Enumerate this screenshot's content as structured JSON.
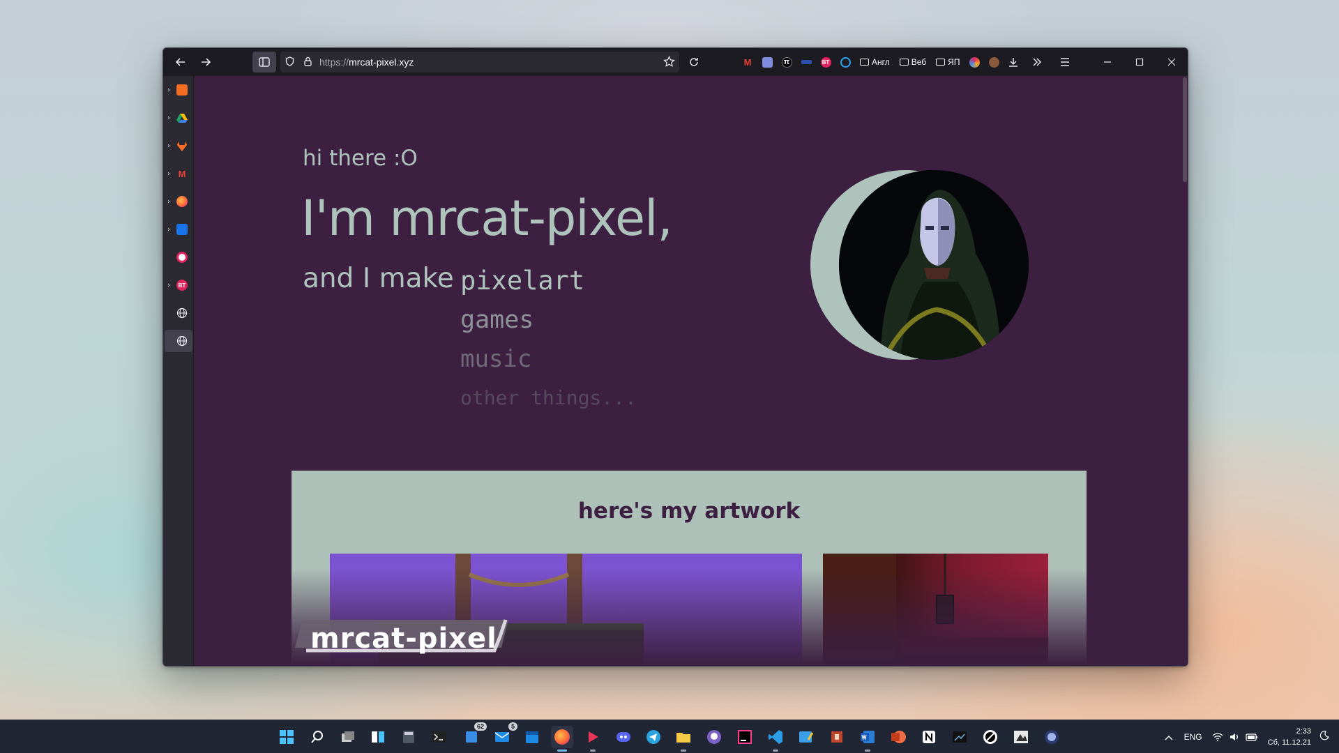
{
  "browser": {
    "url_protocol": "https://",
    "url_host": "mrcat-pixel.xyz",
    "toolbar_extensions": [
      {
        "name": "gmail",
        "label": "M",
        "color": "#ea4335"
      },
      {
        "name": "extension-2",
        "label": "",
        "color": "#7f8ce0"
      },
      {
        "name": "pi",
        "label": "π",
        "color": "#111111"
      },
      {
        "name": "extension-4",
        "label": "",
        "color": "#2c4fb0"
      },
      {
        "name": "bt",
        "label": "BT",
        "color": "#e0245e"
      },
      {
        "name": "opera",
        "label": "O",
        "color": "#2ea3f2"
      }
    ],
    "bookmark_folders": [
      "Англ",
      "Веб",
      "ЯП"
    ]
  },
  "sidebar": {
    "items": [
      {
        "name": "sidebar-item-1",
        "label": "",
        "color": "#f26c22",
        "chevron": true
      },
      {
        "name": "sidebar-item-drive",
        "label": "",
        "color": "#1ea362",
        "chevron": true
      },
      {
        "name": "sidebar-item-gitlab",
        "label": "",
        "color": "#fc6d26",
        "chevron": true
      },
      {
        "name": "sidebar-item-gmail",
        "label": "M",
        "color": "#ea4335",
        "chevron": true
      },
      {
        "name": "sidebar-item-firefox",
        "label": "",
        "color": "#ff7139",
        "chevron": true
      },
      {
        "name": "sidebar-item-messages",
        "label": "",
        "color": "#1a73e8",
        "chevron": true
      },
      {
        "name": "sidebar-item-opera",
        "label": "",
        "color": "#e0245e",
        "chevron": false
      },
      {
        "name": "sidebar-item-bt",
        "label": "BT",
        "color": "#e0245e",
        "chevron": true
      },
      {
        "name": "sidebar-item-web-1",
        "label": "",
        "color": "",
        "chevron": false
      },
      {
        "name": "sidebar-item-web-2",
        "label": "",
        "color": "",
        "chevron": false
      }
    ]
  },
  "page": {
    "greeting": "hi there :O",
    "headline": "I'm mrcat-pixel,",
    "make_prefix": "and I make",
    "things": [
      "pixelart",
      "games",
      "music",
      "other things..."
    ],
    "artwork_heading": "here's my artwork",
    "logo_text": "mrcat-pixel"
  },
  "colors": {
    "page_bg": "#3c1f41",
    "accent_text": "#aec3bc",
    "card_bg": "#aec1b9"
  },
  "taskbar": {
    "apps": [
      {
        "name": "start-button",
        "badge": "",
        "running": false
      },
      {
        "name": "search-button",
        "badge": "",
        "running": false
      },
      {
        "name": "task-view-button",
        "badge": "",
        "running": false
      },
      {
        "name": "snap-layout-app",
        "badge": "",
        "running": false
      },
      {
        "name": "calculator-app",
        "badge": "",
        "running": false
      },
      {
        "name": "terminal-app",
        "badge": "",
        "running": false
      },
      {
        "name": "notes-app",
        "badge": "62",
        "running": false
      },
      {
        "name": "mail-app",
        "badge": "5",
        "running": false
      },
      {
        "name": "calendar-app",
        "badge": "",
        "running": false
      },
      {
        "name": "firefox-app",
        "badge": "",
        "running": true
      },
      {
        "name": "media-player-app",
        "badge": "",
        "running": true
      },
      {
        "name": "discord-app",
        "badge": "",
        "running": false
      },
      {
        "name": "telegram-app",
        "badge": "",
        "running": false
      },
      {
        "name": "file-explorer-app",
        "badge": "",
        "running": true
      },
      {
        "name": "github-app",
        "badge": "",
        "running": false
      },
      {
        "name": "jetbrains-app",
        "badge": "",
        "running": false
      },
      {
        "name": "vscode-app",
        "badge": "",
        "running": true
      },
      {
        "name": "paint-app",
        "badge": "",
        "running": false
      },
      {
        "name": "aseprite-app",
        "badge": "",
        "running": false
      },
      {
        "name": "word-app",
        "badge": "",
        "running": true
      },
      {
        "name": "powerpoint-app",
        "badge": "",
        "running": false
      },
      {
        "name": "notion-app",
        "badge": "",
        "running": false
      },
      {
        "name": "unity-app",
        "badge": "",
        "running": false
      },
      {
        "name": "app-22",
        "badge": "",
        "running": false
      },
      {
        "name": "app-23",
        "badge": "",
        "running": false
      },
      {
        "name": "app-24",
        "badge": "",
        "running": false
      }
    ],
    "language": "ENG",
    "time": "2:33",
    "date": "Сб, 11.12.21"
  }
}
